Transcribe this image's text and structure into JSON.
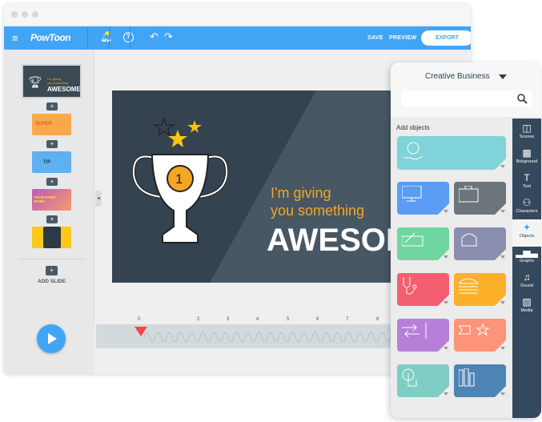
{
  "app": {
    "logo": "PowToon"
  },
  "toolbar": {
    "save": "SAVE",
    "preview": "PREVIEW",
    "export": "EXPORT",
    "icons": [
      "menu-icon",
      "bell-icon",
      "help-icon",
      "undo-icon",
      "redo-icon"
    ],
    "accent": "#42a4f5"
  },
  "slides": {
    "add_slide": "ADD SLIDE",
    "thumb1": {
      "line1": "I'm giving",
      "line2": "you something",
      "title": "AWESOME"
    },
    "thumb2": "SUPER",
    "thumb3": "TIP",
    "thumb4": "YOUR HARD WORK"
  },
  "slide": {
    "line1": "I'm giving",
    "line2": "you something",
    "title": "AWESOME",
    "trophy_number": "1"
  },
  "timeline": {
    "ticks": [
      "0",
      "2",
      "3",
      "4",
      "5",
      "6",
      "7",
      "8"
    ]
  },
  "panel": {
    "category": "Creative Business",
    "search_placeholder": "",
    "section": "Add objects",
    "sidebar": [
      {
        "label": "Scenes",
        "icon": "layout-icon"
      },
      {
        "label": "Bckground",
        "icon": "pattern-icon"
      },
      {
        "label": "Text",
        "icon": "text-icon"
      },
      {
        "label": "Characters",
        "icon": "people-icon"
      },
      {
        "label": "Objects",
        "icon": "objects-icon",
        "active": true
      },
      {
        "label": "Graphs",
        "icon": "graph-icon"
      },
      {
        "label": "Sound",
        "icon": "music-icon"
      },
      {
        "label": "Media",
        "icon": "image-icon"
      }
    ],
    "tiles": [
      {
        "icon": "globe-hand-icon",
        "color": "#80d3d8"
      },
      {
        "icon": "monitor-icon",
        "color": "#5b9cf5"
      },
      {
        "icon": "briefcase-icon",
        "color": "#6b757b"
      },
      {
        "icon": "check-pen-icon",
        "color": "#6fd6a0"
      },
      {
        "icon": "armchair-icon",
        "color": "#8a8fb0"
      },
      {
        "icon": "stethoscope-icon",
        "color": "#f35f70"
      },
      {
        "icon": "burger-icon",
        "color": "#fdb02a"
      },
      {
        "icon": "arrows-icon",
        "color": "#b87fd8"
      },
      {
        "icon": "flag-star-icon",
        "color": "#fd9479"
      },
      {
        "icon": "touch-icon",
        "color": "#7fcdc4"
      },
      {
        "icon": "books-icon",
        "color": "#4c85b4"
      }
    ]
  }
}
